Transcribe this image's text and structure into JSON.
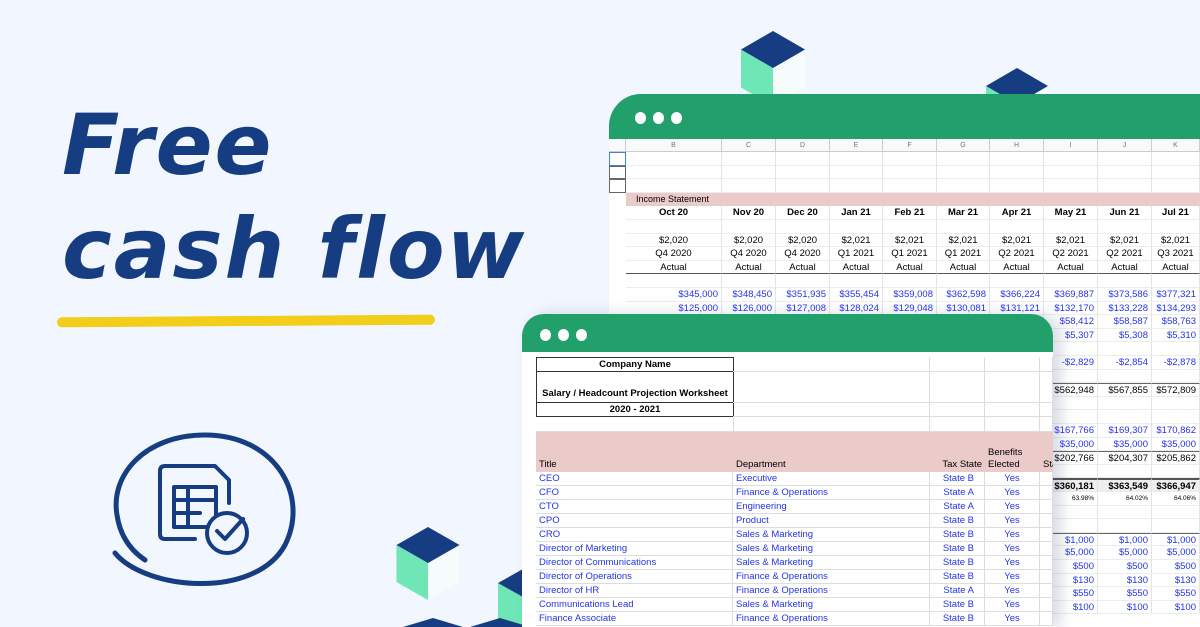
{
  "headline": {
    "line1": "Free",
    "line2": "cash flow"
  },
  "colors": {
    "brand_navy": "#163c82",
    "window_green": "#22a06b",
    "accent_yellow": "#f2ce1a",
    "cube_mint": "#6ee6b6",
    "link_blue": "#2233ee",
    "header_pink": "#ebcaca"
  },
  "icon": "spreadsheet-check-icon",
  "back_sheet": {
    "column_headers": [
      "B",
      "C",
      "D",
      "E",
      "F",
      "G",
      "H",
      "I",
      "J",
      "K"
    ],
    "section_label": "Income Statement",
    "rows": [
      {
        "style": "month",
        "cells": [
          "Oct 20",
          "Nov 20",
          "Dec 20",
          "Jan 21",
          "Feb 21",
          "Mar 21",
          "Apr 21",
          "May 21",
          "Jun 21",
          "Jul 21"
        ]
      },
      {
        "style": "plain",
        "cells": [
          "",
          "",
          "",
          "",
          "",
          "",
          "",
          "",
          "",
          ""
        ]
      },
      {
        "style": "center",
        "cells": [
          "$2,020",
          "$2,020",
          "$2,020",
          "$2,021",
          "$2,021",
          "$2,021",
          "$2,021",
          "$2,021",
          "$2,021",
          "$2,021"
        ]
      },
      {
        "style": "center",
        "cells": [
          "Q4 2020",
          "Q4 2020",
          "Q4 2020",
          "Q1 2021",
          "Q1 2021",
          "Q1 2021",
          "Q2 2021",
          "Q2 2021",
          "Q2 2021",
          "Q3 2021"
        ]
      },
      {
        "style": "center-underline",
        "cells": [
          "Actual",
          "Actual",
          "Actual",
          "Actual",
          "Actual",
          "Actual",
          "Actual",
          "Actual",
          "Actual",
          "Actual"
        ]
      },
      {
        "style": "plain",
        "cells": [
          "",
          "",
          "",
          "",
          "",
          "",
          "",
          "",
          "",
          ""
        ]
      },
      {
        "style": "blue",
        "cells": [
          "$345,000",
          "$348,450",
          "$351,935",
          "$355,454",
          "$359,008",
          "$362,598",
          "$366,224",
          "$369,887",
          "$373,586",
          "$377,321"
        ]
      },
      {
        "style": "blue",
        "cells": [
          "$125,000",
          "$126,000",
          "$127,008",
          "$128,024",
          "$129,048",
          "$130,081",
          "$131,121",
          "$132,170",
          "$133,228",
          "$134,293"
        ]
      },
      {
        "style": "blue",
        "cells": [
          "",
          "",
          "",
          "",
          "",
          "",
          "",
          "$58,412",
          "$58,587",
          "$58,763"
        ]
      },
      {
        "style": "blue",
        "cells": [
          "",
          "",
          "",
          "",
          "",
          "",
          "",
          "$5,307",
          "$5,308",
          "$5,310"
        ]
      },
      {
        "style": "plain",
        "cells": [
          "",
          "",
          "",
          "",
          "",
          "",
          "",
          "",
          "",
          ""
        ]
      },
      {
        "style": "blue",
        "cells": [
          "",
          "",
          "",
          "",
          "",
          "",
          "",
          "-$2,829",
          "-$2,854",
          "-$2,878"
        ]
      },
      {
        "style": "plain",
        "cells": [
          "",
          "",
          "",
          "",
          "",
          "",
          "",
          "",
          "",
          ""
        ]
      },
      {
        "style": "total",
        "cells": [
          "",
          "",
          "",
          "",
          "",
          "",
          "",
          "$562,948",
          "$567,855",
          "$572,809"
        ]
      },
      {
        "style": "plain",
        "cells": [
          "",
          "",
          "",
          "",
          "",
          "",
          "",
          "",
          "",
          ""
        ]
      },
      {
        "style": "plain",
        "cells": [
          "",
          "",
          "",
          "",
          "",
          "",
          "",
          "",
          "",
          ""
        ]
      },
      {
        "style": "blue",
        "cells": [
          "",
          "",
          "",
          "",
          "",
          "",
          "",
          "$167,766",
          "$169,307",
          "$170,862"
        ]
      },
      {
        "style": "blue",
        "cells": [
          "",
          "",
          "",
          "",
          "",
          "",
          "",
          "$35,000",
          "$35,000",
          "$35,000"
        ]
      },
      {
        "style": "total",
        "cells": [
          "",
          "",
          "",
          "",
          "",
          "",
          "",
          "$202,766",
          "$204,307",
          "$205,862"
        ]
      },
      {
        "style": "plain",
        "cells": [
          "",
          "",
          "",
          "",
          "",
          "",
          "",
          "",
          "",
          ""
        ]
      },
      {
        "style": "grand",
        "cells": [
          "",
          "",
          "",
          "",
          "",
          "",
          "",
          "$360,181",
          "$363,549",
          "$366,947"
        ]
      },
      {
        "style": "pct",
        "cells": [
          "",
          "",
          "",
          "",
          "",
          "",
          "",
          "63.98%",
          "64.02%",
          "64.06%"
        ]
      },
      {
        "style": "plain",
        "cells": [
          "",
          "",
          "",
          "",
          "",
          "",
          "",
          "",
          "",
          ""
        ]
      },
      {
        "style": "plain",
        "cells": [
          "",
          "",
          "",
          "",
          "",
          "",
          "",
          "",
          "",
          ""
        ]
      },
      {
        "style": "blue-top",
        "cells": [
          "",
          "",
          "",
          "",
          "",
          "",
          "",
          "$1,000",
          "$1,000",
          "$1,000"
        ]
      },
      {
        "style": "blue",
        "cells": [
          "",
          "",
          "",
          "",
          "",
          "",
          "",
          "$5,000",
          "$5,000",
          "$5,000"
        ]
      },
      {
        "style": "blue",
        "cells": [
          "",
          "",
          "",
          "",
          "",
          "",
          "",
          "$500",
          "$500",
          "$500"
        ]
      },
      {
        "style": "blue",
        "cells": [
          "",
          "",
          "",
          "",
          "",
          "",
          "",
          "$130",
          "$130",
          "$130"
        ]
      },
      {
        "style": "blue",
        "cells": [
          "",
          "",
          "",
          "",
          "",
          "",
          "",
          "$550",
          "$550",
          "$550"
        ]
      },
      {
        "style": "blue",
        "cells": [
          "",
          "",
          "",
          "",
          "",
          "",
          "",
          "$100",
          "$100",
          "$100"
        ]
      }
    ]
  },
  "front_sheet": {
    "company_name": "Company Name",
    "worksheet_title": "Salary / Headcount Projection Worksheet",
    "period": "2020 - 2021",
    "headers": [
      "Title",
      "Department",
      "Tax State",
      "Benefits Elected",
      "Sta"
    ],
    "rows": [
      [
        "CEO",
        "Executive",
        "State B",
        "Yes"
      ],
      [
        "CFO",
        "Finance & Operations",
        "State A",
        "Yes"
      ],
      [
        "CTO",
        "Engineering",
        "State A",
        "Yes"
      ],
      [
        "CPO",
        "Product",
        "State B",
        "Yes"
      ],
      [
        "CRO",
        "Sales & Marketing",
        "State B",
        "Yes"
      ],
      [
        "Director of Marketing",
        "Sales & Marketing",
        "State B",
        "Yes"
      ],
      [
        "Director of Communications",
        "Sales & Marketing",
        "State B",
        "Yes"
      ],
      [
        "Director of Operations",
        "Finance & Operations",
        "State B",
        "Yes"
      ],
      [
        "Director of HR",
        "Finance & Operations",
        "State A",
        "Yes"
      ],
      [
        "Communications Lead",
        "Sales & Marketing",
        "State B",
        "Yes"
      ],
      [
        "Finance Associate",
        "Finance & Operations",
        "State B",
        "Yes"
      ]
    ]
  }
}
